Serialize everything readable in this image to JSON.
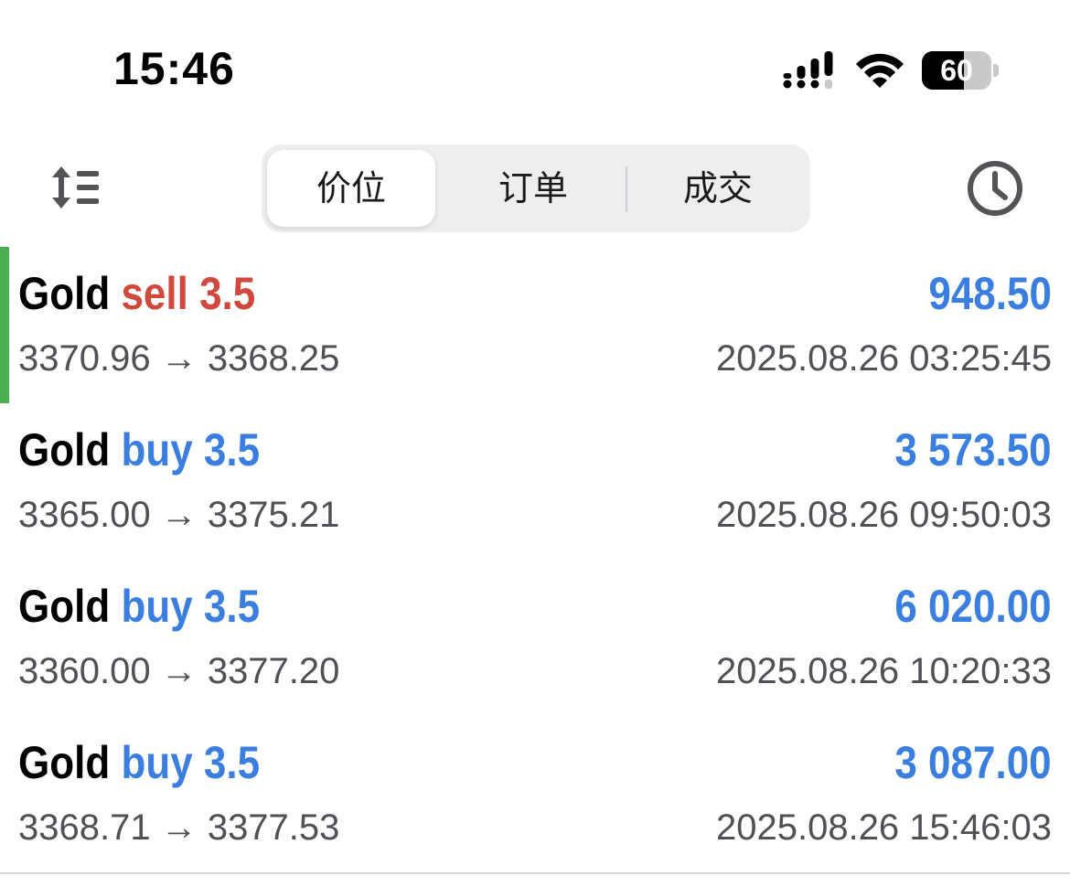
{
  "status_bar": {
    "time": "15:46",
    "battery_level": 60,
    "battery_text": "60"
  },
  "toolbar": {
    "tabs": [
      {
        "label": "价位",
        "active": true
      },
      {
        "label": "订单",
        "active": false
      },
      {
        "label": "成交",
        "active": false
      }
    ]
  },
  "colors": {
    "sell": "#d1483d",
    "buy": "#3a7fe0",
    "profit": "#3a7fe0",
    "accent": "#4caf50",
    "secondary_text": "#505056"
  },
  "deals": [
    {
      "symbol": "Gold",
      "type": "sell",
      "volume": "3.5",
      "profit": "948.50",
      "prices": "3370.96 → 3368.25",
      "time": "2025.08.26 03:25:45",
      "highlighted": true
    },
    {
      "symbol": "Gold",
      "type": "buy",
      "volume": "3.5",
      "profit": "3 573.50",
      "prices": "3365.00 → 3375.21",
      "time": "2025.08.26 09:50:03",
      "highlighted": false
    },
    {
      "symbol": "Gold",
      "type": "buy",
      "volume": "3.5",
      "profit": "6 020.00",
      "prices": "3360.00 → 3377.20",
      "time": "2025.08.26 10:20:33",
      "highlighted": false
    },
    {
      "symbol": "Gold",
      "type": "buy",
      "volume": "3.5",
      "profit": "3 087.00",
      "prices": "3368.71 → 3377.53",
      "time": "2025.08.26 15:46:03",
      "highlighted": false
    }
  ]
}
